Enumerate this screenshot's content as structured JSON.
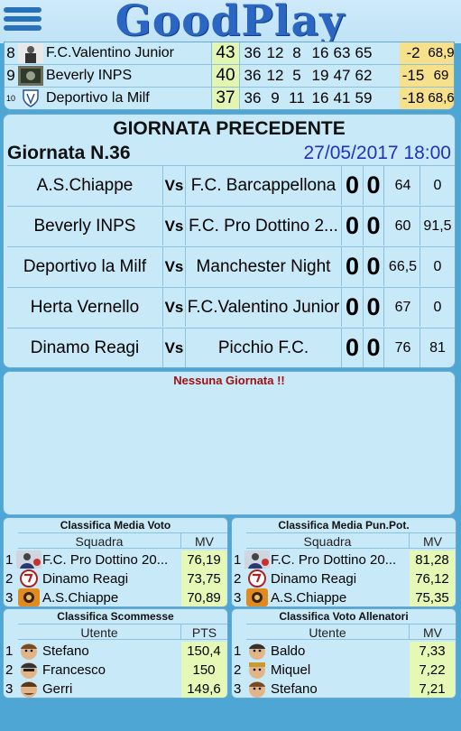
{
  "app": {
    "logo": "GoodPlay"
  },
  "ranking": [
    {
      "pos": "8",
      "team": "F.C.Valentino Junior",
      "pts": "43",
      "g1": "36",
      "g2": "12",
      "g3": "8",
      "g4": "16",
      "g5": "63",
      "g6": "65",
      "diff": "-2",
      "mv": "68,9"
    },
    {
      "pos": "9",
      "team": "Beverly INPS",
      "pts": "40",
      "g1": "36",
      "g2": "12",
      "g3": "5",
      "g4": "19",
      "g5": "47",
      "g6": "62",
      "diff": "-15",
      "mv": "69"
    },
    {
      "pos": "10",
      "team": "Deportivo la Milf",
      "pts": "37",
      "g1": "36",
      "g2": "9",
      "g3": "11",
      "g4": "16",
      "g5": "41",
      "g6": "59",
      "diff": "-18",
      "mv": "68,6"
    }
  ],
  "previous": {
    "title": "GIORNATA PRECEDENTE",
    "round": "Giornata N.36",
    "date": "27/05/2017 18:00",
    "vs": "Vs",
    "matches": [
      {
        "home": "A.S.Chiappe",
        "away": "F.C. Barcappellona",
        "s1": "0",
        "s2": "0",
        "v1": "64",
        "v2": "0"
      },
      {
        "home": "Beverly INPS",
        "away": "F.C. Pro Dottino 2...",
        "s1": "0",
        "s2": "0",
        "v1": "60",
        "v2": "91,5"
      },
      {
        "home": "Deportivo la Milf",
        "away": "Manchester Night",
        "s1": "0",
        "s2": "0",
        "v1": "66,5",
        "v2": "0"
      },
      {
        "home": "Herta Vernello",
        "away": "F.C.Valentino Junior",
        "s1": "0",
        "s2": "0",
        "v1": "67",
        "v2": "0"
      },
      {
        "home": "Dinamo Reagi",
        "away": "Picchio F.C.",
        "s1": "0",
        "s2": "0",
        "v1": "76",
        "v2": "81"
      }
    ]
  },
  "next": {
    "message": "Nessuna Giornata !!"
  },
  "panels": [
    {
      "title": "Classifica Media Voto",
      "col1": "Squadra",
      "col2": "MV",
      "rows": [
        {
          "n": "1",
          "name": "F.C. Pro Dottino 20...",
          "val": "76,19"
        },
        {
          "n": "2",
          "name": "Dinamo Reagi",
          "val": "73,75"
        },
        {
          "n": "3",
          "name": "A.S.Chiappe",
          "val": "70,89"
        }
      ]
    },
    {
      "title": "Classifica Media Pun.Pot.",
      "col1": "Squadra",
      "col2": "MV",
      "rows": [
        {
          "n": "1",
          "name": "F.C. Pro Dottino 20...",
          "val": "81,28"
        },
        {
          "n": "2",
          "name": "Dinamo Reagi",
          "val": "76,12"
        },
        {
          "n": "3",
          "name": "A.S.Chiappe",
          "val": "75,35"
        }
      ]
    },
    {
      "title": "Classifica Scommesse",
      "col1": "Utente",
      "col2": "PTS",
      "rows": [
        {
          "n": "1",
          "name": "Stefano",
          "val": "150,4"
        },
        {
          "n": "2",
          "name": "Francesco",
          "val": "150"
        },
        {
          "n": "3",
          "name": "Gerri",
          "val": "149,6"
        }
      ]
    },
    {
      "title": "Classifica Voto Allenatori",
      "col1": "Utente",
      "col2": "MV",
      "rows": [
        {
          "n": "1",
          "name": "Baldo",
          "val": "7,33"
        },
        {
          "n": "2",
          "name": "Miquel",
          "val": "7,22"
        },
        {
          "n": "3",
          "name": "Stefano",
          "val": "7,21"
        }
      ]
    }
  ]
}
